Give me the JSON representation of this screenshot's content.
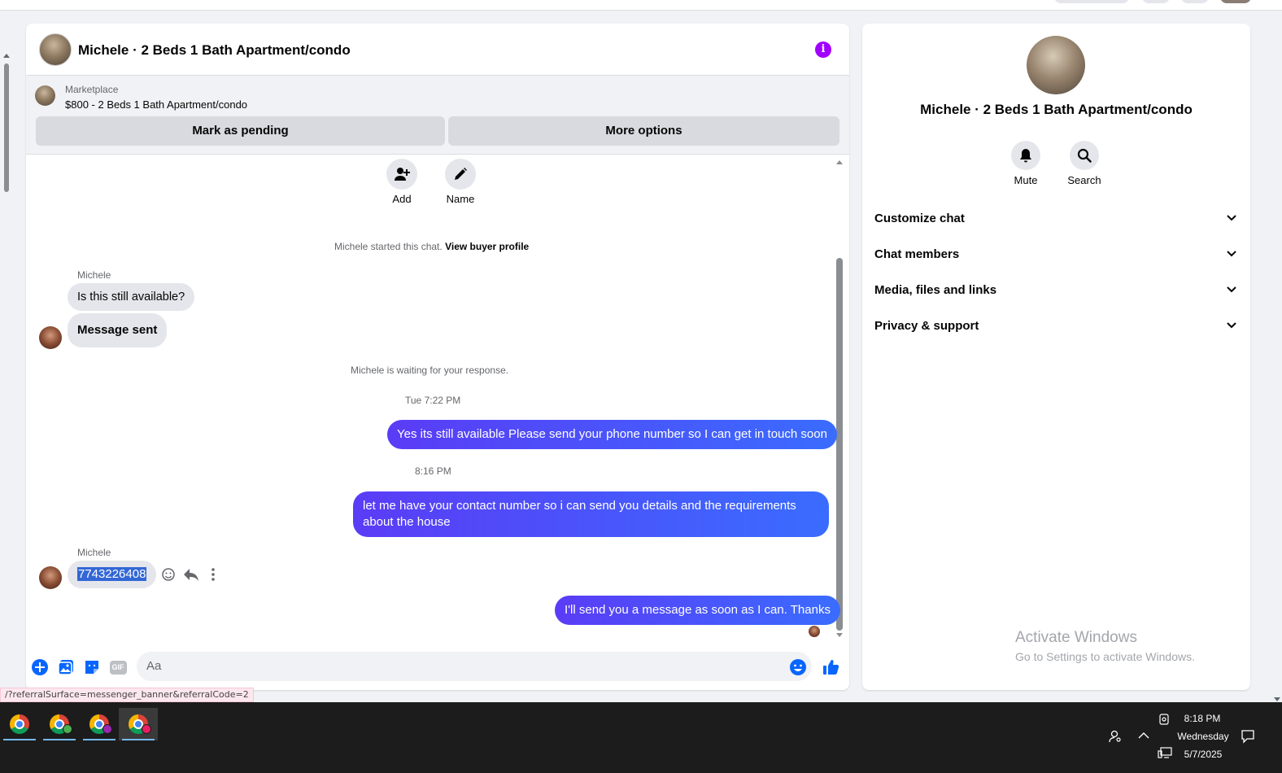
{
  "chat": {
    "title": "Michele · 2 Beds 1 Bath Apartment/condo",
    "marketplace_label": "Marketplace",
    "listing": "$800 - 2 Beds 1 Bath Apartment/condo",
    "mark_pending": "Mark as pending",
    "more_options": "More options",
    "actions": [
      {
        "label": "Add",
        "icon": "add-person-icon"
      },
      {
        "label": "Name",
        "icon": "pencil-icon"
      }
    ],
    "started_text": "Michele started this chat.",
    "view_profile": "View buyer profile",
    "messages": {
      "sender1": "Michele",
      "in1": "Is this still available?",
      "in2": "Message sent",
      "waiting": "Michele is waiting for your response.",
      "ts1": "Tue 7:22 PM",
      "out1": "Yes its still available Please send your phone number so I can get in touch soon",
      "ts2": "8:16 PM",
      "out2": "let me have your contact number so i can send you details and the requirements about the house",
      "sender2": "Michele",
      "in3": "7743226408",
      "out3": "I'll send you a message as soon as I can. Thanks"
    },
    "composer_placeholder": "Aa",
    "gif_label": "GIF"
  },
  "info_panel": {
    "name": "Michele · 2 Beds 1 Bath Apartment/condo",
    "mute": "Mute",
    "search": "Search",
    "rows": [
      "Customize chat",
      "Chat members",
      "Media, files and links",
      "Privacy & support"
    ],
    "activate_title": "Activate Windows",
    "activate_sub": "Go to Settings to activate Windows."
  },
  "status_url": "/?referralSurface=messenger_banner&referralCode=2",
  "taskbar": {
    "time": "8:18 PM",
    "day": "Wednesday",
    "date": "5/7/2025"
  },
  "colors": {
    "accent": "#0866ff",
    "outgoing_start": "#5a3cf6",
    "outgoing_end": "#3a6cff",
    "info": "#a100ff"
  }
}
